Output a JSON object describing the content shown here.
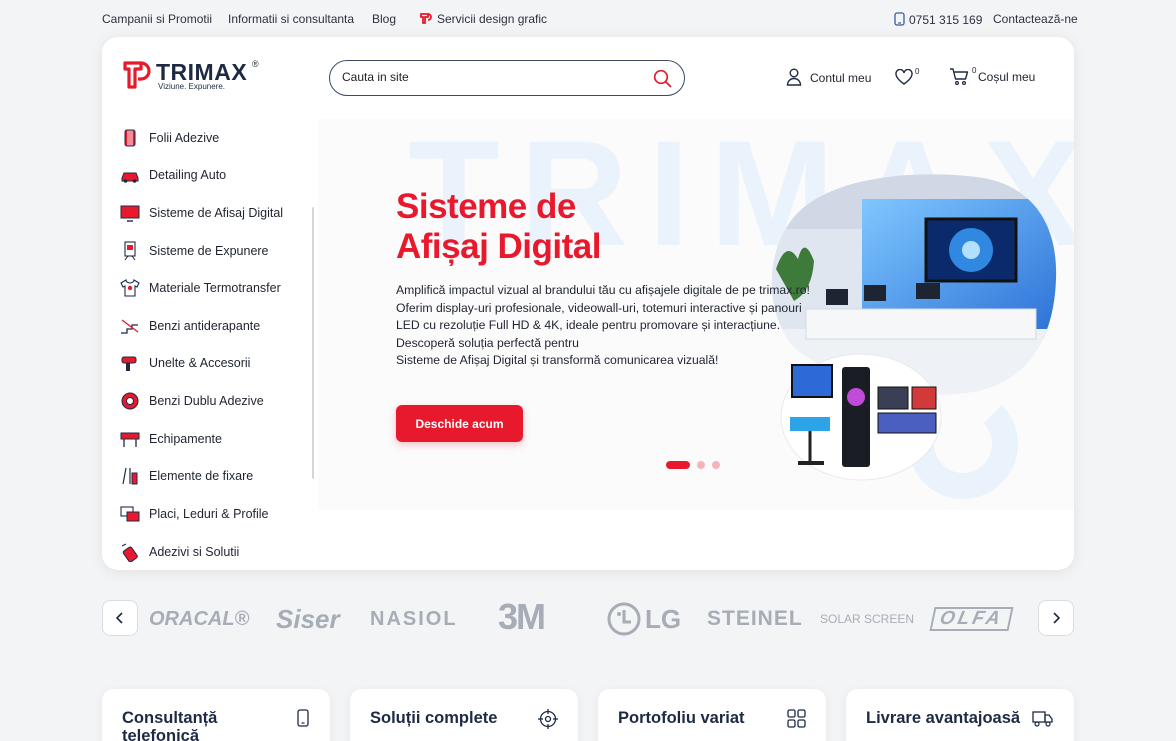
{
  "topbar": {
    "links": [
      "Campanii si Promotii",
      "Informatii si consultanta",
      "Blog",
      "Servicii design grafic"
    ],
    "phone": "0751 315 169",
    "contact": "Contactează-ne"
  },
  "header": {
    "logo_name": "TRIMAX",
    "logo_reg": "®",
    "logo_tagline": "Viziune. Expunere.",
    "search_placeholder": "Cauta in site",
    "account_label": "Contul meu",
    "wishlist_count": "0",
    "cart_count": "0",
    "cart_label": "Coșul meu"
  },
  "sidebar": {
    "items": [
      {
        "label": "Folii Adezive",
        "icon": "vinyl-roll-icon"
      },
      {
        "label": "Detailing Auto",
        "icon": "car-icon"
      },
      {
        "label": "Sisteme de Afisaj Digital",
        "icon": "monitor-icon"
      },
      {
        "label": "Sisteme de Expunere",
        "icon": "display-stand-icon"
      },
      {
        "label": "Materiale Termotransfer",
        "icon": "tshirt-icon"
      },
      {
        "label": "Benzi antiderapante",
        "icon": "stairs-icon"
      },
      {
        "label": "Unelte & Accesorii",
        "icon": "heat-gun-icon"
      },
      {
        "label": "Benzi Dublu Adezive",
        "icon": "tape-roll-icon"
      },
      {
        "label": "Echipamente",
        "icon": "plotter-icon"
      },
      {
        "label": "Elemente de fixare",
        "icon": "fixing-tools-icon"
      },
      {
        "label": "Placi, Leduri & Profile",
        "icon": "panels-icon"
      },
      {
        "label": "Adezivi si Solutii",
        "icon": "spray-icon"
      }
    ]
  },
  "hero": {
    "bg_word": "TRIMAX",
    "title_line1": "Sisteme de",
    "title_line2": "Afișaj Digital",
    "desc": [
      "Amplifică impactul vizual al brandului tău cu afișajele digitale de pe trimax.ro!",
      "Oferim display-uri profesionale, videowall-uri, totemuri interactive și panouri",
      "LED cu rezoluție Full HD & 4K, ideale pentru promovare și interacțiune.",
      "Descoperă soluția perfectă pentru",
      "Sisteme de Afișaj Digital și transformă comunicarea vizuală!"
    ],
    "button": "Deschide acum",
    "slides": 3,
    "active_slide": 1
  },
  "brands": [
    "ORACAL®",
    "Siser",
    "NASIOL",
    "3M",
    "LG",
    "STEINEL",
    "SOLAR SCREEN",
    "OLFA"
  ],
  "features": [
    {
      "title": "Consultanță telefonică",
      "icon": "phone-icon"
    },
    {
      "title": "Soluții complete",
      "icon": "target-icon"
    },
    {
      "title": "Portofoliu variat",
      "icon": "grid-icon"
    },
    {
      "title": "Livrare avantajoasă",
      "icon": "truck-icon"
    }
  ],
  "colors": {
    "brand_red": "#e8192c",
    "navy": "#1e2a44",
    "bg": "#f3f4f6"
  }
}
